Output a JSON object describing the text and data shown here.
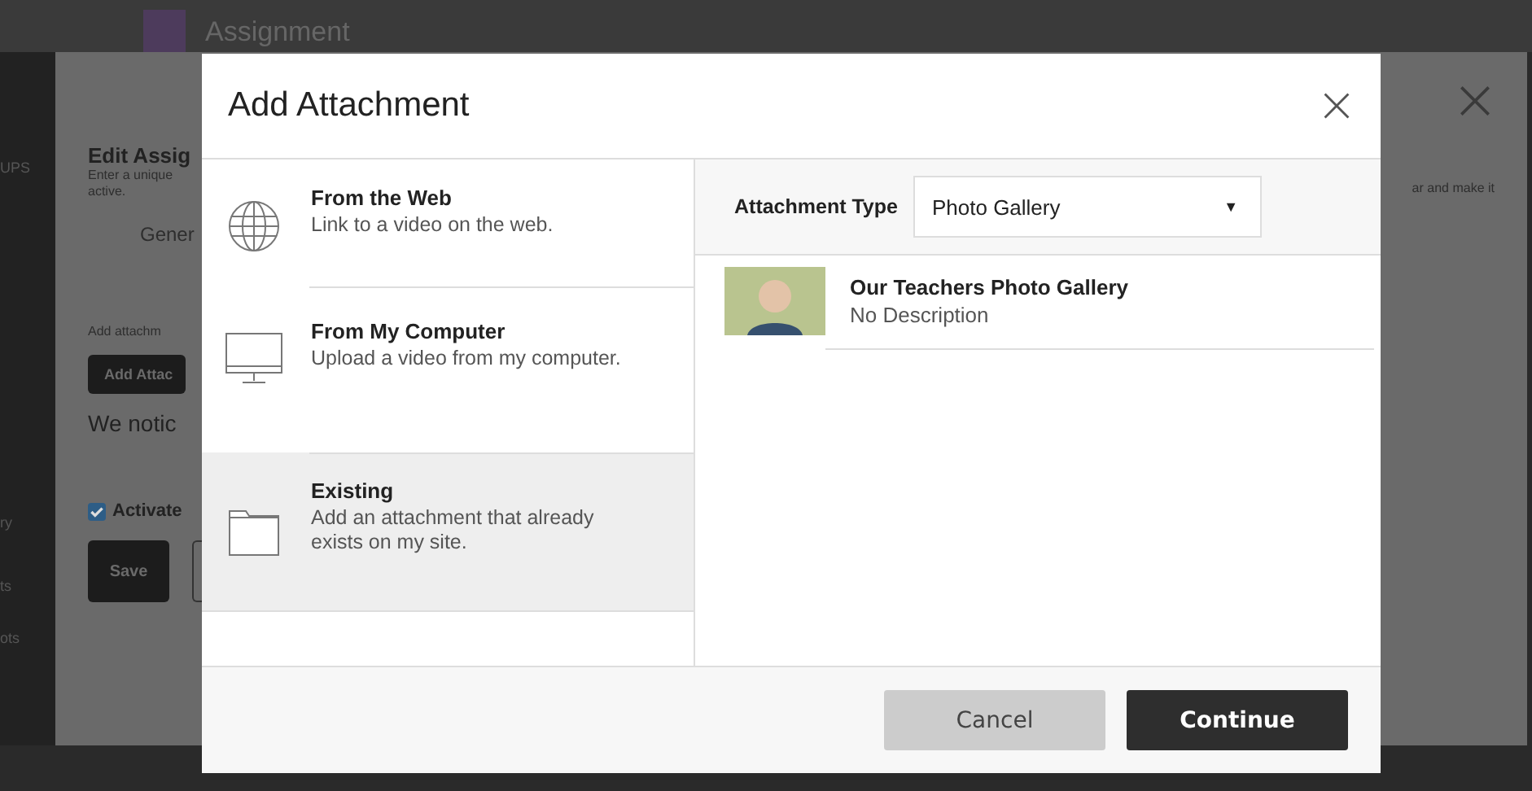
{
  "page": {
    "title": "Assignment",
    "sidebar_fragments": [
      "UPS",
      "ry",
      "ts",
      "ots"
    ]
  },
  "background_dialog": {
    "title": "Edit Assig",
    "description": [
      "Enter a unique",
      "active."
    ],
    "description_tail": "ar and make it",
    "tab": "Gener",
    "attach_label": "Add attachm",
    "attach_button": "Add Attac",
    "notice": "We notic",
    "activate": {
      "label": "Activate",
      "checked": true
    },
    "save_button": "Save"
  },
  "modal": {
    "title": "Add Attachment",
    "sources": [
      {
        "kind": "web",
        "title": "From the Web",
        "description": "Link to a video on the web.",
        "selected": false
      },
      {
        "kind": "computer",
        "title": "From My Computer",
        "description": "Upload a video from my computer.",
        "selected": false
      },
      {
        "kind": "folder",
        "title": "Existing",
        "description": "Add an attachment that already exists on my site.",
        "selected": true
      }
    ],
    "attachment_type": {
      "label": "Attachment Type",
      "value": "Photo Gallery",
      "caret": "▼"
    },
    "items": [
      {
        "title": "Our Teachers Photo Gallery",
        "description": "No Description"
      }
    ],
    "buttons": [
      {
        "kind": "secondary",
        "label": "Cancel"
      },
      {
        "kind": "primary",
        "label": "Continue"
      }
    ]
  }
}
